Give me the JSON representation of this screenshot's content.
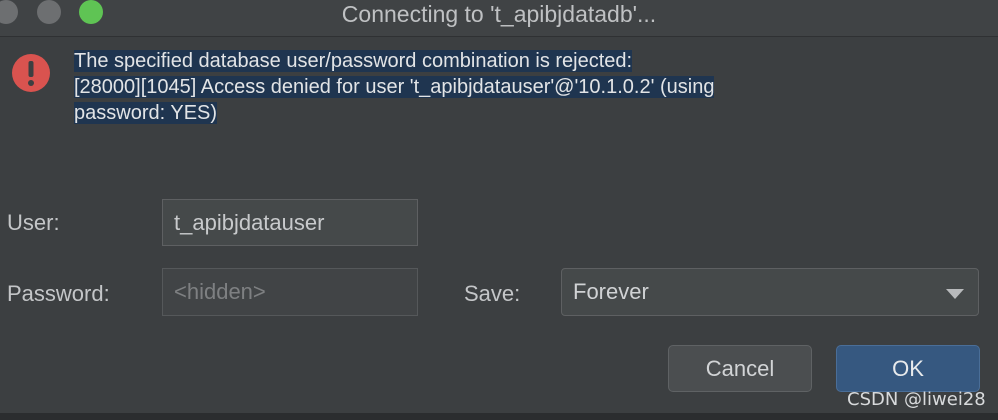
{
  "window": {
    "title": "Connecting to 't_apibjdatadb'..."
  },
  "error": {
    "icon": "error-icon",
    "line1": "The specified database user/password combination is rejected:",
    "line2": "[28000][1045] Access denied for user 't_apibjdatauser'@'10.1.0.2' (using",
    "line3": "password: YES)"
  },
  "form": {
    "user_label": "User:",
    "user_value": "t_apibjdatauser",
    "password_label": "Password:",
    "password_placeholder": "<hidden>",
    "save_label": "Save:",
    "save_value": "Forever"
  },
  "buttons": {
    "cancel": "Cancel",
    "ok": "OK"
  },
  "watermark": "CSDN @liwei28",
  "colors": {
    "background": "#3c3f41",
    "error_red": "#d9534f",
    "ok_blue": "#365880",
    "selection": "#1f3550"
  }
}
